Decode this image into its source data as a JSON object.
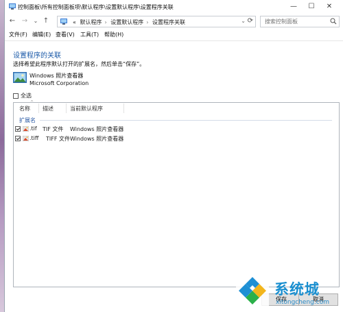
{
  "window": {
    "title": "控制面板\\所有控制面板项\\默认程序\\设置默认程序\\设置程序关联",
    "minimize": "—",
    "maximize": "☐",
    "close": "✕"
  },
  "nav": {
    "back": "←",
    "forward": "→",
    "recent": "⌄",
    "up": "↑"
  },
  "address": {
    "prefix": "«",
    "crumbs": [
      "默认程序",
      "设置默认程序",
      "设置程序关联"
    ],
    "separator": "›",
    "dropdown": "⌄",
    "refresh": "⟳"
  },
  "search": {
    "placeholder": "搜索控制面板"
  },
  "menu": {
    "file": "文件(F)",
    "edit": "编辑(E)",
    "view": "查看(V)",
    "tools": "工具(T)",
    "help": "帮助(H)"
  },
  "content": {
    "heading": "设置程序的关联",
    "instruction": "选择希望此程序默认打开的扩展名，然后单击“保存”。",
    "program_name": "Windows 照片查看器",
    "publisher": "Microsoft Corporation",
    "select_all": "全选"
  },
  "list": {
    "columns": [
      "名称",
      "描述",
      "当前默认程序"
    ],
    "group": "扩展名",
    "rows": [
      {
        "ext": ".tif",
        "desc": "TIF 文件",
        "current": "Windows 照片查看器",
        "checked": true
      },
      {
        "ext": ".tiff",
        "desc": "TIFF 文件",
        "current": "Windows 照片查看器",
        "checked": true
      }
    ]
  },
  "buttons": {
    "save": "保存",
    "cancel": "取消"
  },
  "watermark": {
    "name": "系统城",
    "url": "xitongcheng.com"
  },
  "colors": {
    "heading": "#1b5aa8",
    "group": "#2455a2",
    "watermark": "#1a8fd0"
  }
}
